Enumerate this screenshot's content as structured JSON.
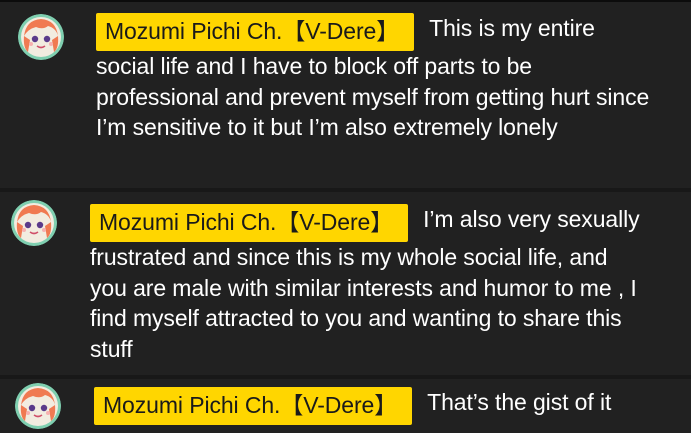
{
  "messages": [
    {
      "author": "Mozumi Pichi Ch.【V-Dere】",
      "avatar": "avatar-icon",
      "text": "This is my entire social life and I have to block off parts to be professional and prevent myself from getting hurt since I’m sensitive to it but I’m also extremely lonely"
    },
    {
      "author": "Mozumi Pichi Ch.【V-Dere】",
      "avatar": "avatar-icon",
      "text": "I’m also very sexually frustrated and since this is my whole social life, and you are male with similar interests and humor to me , I find myself attracted to you and wanting to share this stuff"
    },
    {
      "author": "Mozumi Pichi Ch.【V-Dere】",
      "avatar": "avatar-icon",
      "text": "That’s the gist of it"
    }
  ],
  "colors": {
    "background": "#181818",
    "message_bg": "#212121",
    "author_badge": "#ffd600",
    "text": "#ffffff"
  }
}
